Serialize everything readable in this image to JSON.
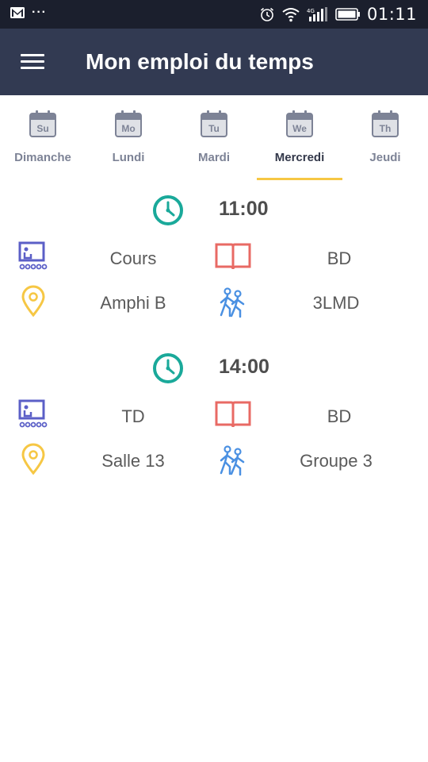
{
  "status_bar": {
    "time": "01:11",
    "left_icons": [
      "gmail-icon",
      "more-dots-icon"
    ],
    "right_icons": [
      "alarm-icon",
      "wifi-icon",
      "signal-icon",
      "battery-icon"
    ],
    "dots": "···"
  },
  "app_bar": {
    "title": "Mon emploi du temps",
    "menu_icon": "hamburger-menu-icon"
  },
  "tabs": [
    {
      "abbr": "Su",
      "label": "Dimanche"
    },
    {
      "abbr": "Mo",
      "label": "Lundi"
    },
    {
      "abbr": "Tu",
      "label": "Mardi"
    },
    {
      "abbr": "We",
      "label": "Mercredi",
      "active": true
    },
    {
      "abbr": "Th",
      "label": "Jeudi"
    }
  ],
  "sessions": [
    {
      "time": "11:00",
      "type": "Cours",
      "subject": "BD",
      "room": "Amphi B",
      "group": "3LMD"
    },
    {
      "time": "14:00",
      "type": "TD",
      "subject": "BD",
      "room": "Salle 13",
      "group": "Groupe 3"
    }
  ],
  "colors": {
    "status_bar": "#1b1f2d",
    "app_bar": "#323a52",
    "tab_indicator": "#f6c744",
    "clock": "#1aa99a",
    "classroom_icon": "#5b5fc7",
    "book_icon": "#e86a64",
    "location_icon": "#f6c744",
    "group_icon": "#4a90e2"
  }
}
